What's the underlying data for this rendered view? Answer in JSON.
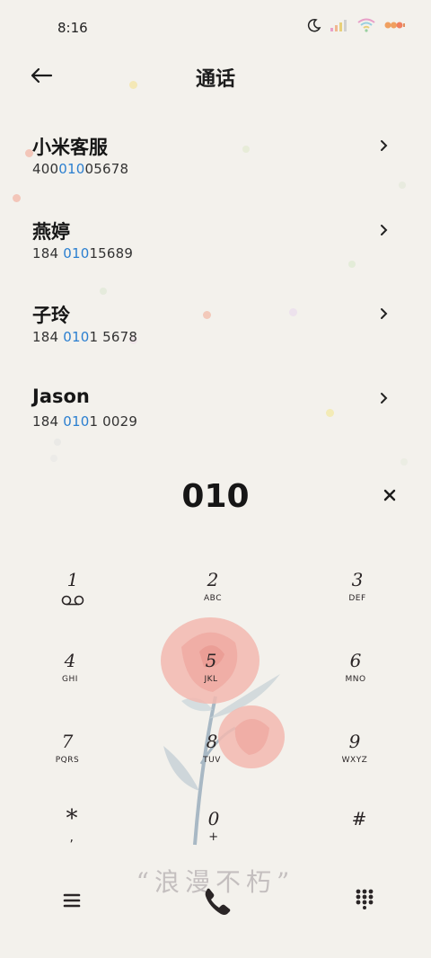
{
  "status": {
    "time": "8:16",
    "icons": [
      "moon-icon",
      "signal-icon",
      "wifi-icon",
      "battery-icon"
    ]
  },
  "header": {
    "title": "通话",
    "back_icon": "back-arrow-icon"
  },
  "contacts": [
    {
      "name": "小米客服",
      "number_prefix": "400",
      "number_match": "010",
      "number_suffix": "05678"
    },
    {
      "name": "燕婷",
      "number_prefix": "184 ",
      "number_match": "010",
      "number_suffix": "15689"
    },
    {
      "name": "子玲",
      "number_prefix": "184 ",
      "number_match": "010",
      "number_suffix": "1 5678"
    },
    {
      "name": "Jason",
      "number_prefix": "184 ",
      "number_match": "010",
      "number_suffix": "1 0029"
    }
  ],
  "dial": {
    "number": "010",
    "clear_icon": "close-icon"
  },
  "keypad": [
    {
      "digit": "1",
      "letters": ""
    },
    {
      "digit": "2",
      "letters": "ABC"
    },
    {
      "digit": "3",
      "letters": "DEF"
    },
    {
      "digit": "4",
      "letters": "GHI"
    },
    {
      "digit": "5",
      "letters": "JKL"
    },
    {
      "digit": "6",
      "letters": "MNO"
    },
    {
      "digit": "7",
      "letters": "PQRS"
    },
    {
      "digit": "8",
      "letters": "TUV"
    },
    {
      "digit": "9",
      "letters": "WXYZ"
    },
    {
      "digit": "*",
      "letters": ","
    },
    {
      "digit": "0",
      "letters": "+"
    },
    {
      "digit": "#",
      "letters": ""
    }
  ],
  "slogan": "“浪漫不朽”",
  "colors": {
    "background": "#f3f1ec",
    "match_highlight": "#2b7fd0",
    "text": "#161616"
  }
}
